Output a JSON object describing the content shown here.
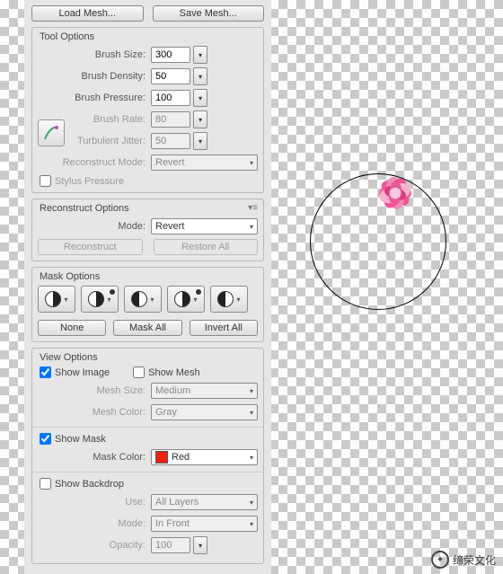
{
  "top_buttons": {
    "load_mesh": "Load Mesh...",
    "save_mesh": "Save Mesh..."
  },
  "tool_options": {
    "title": "Tool Options",
    "brush_size_label": "Brush Size:",
    "brush_size": "300",
    "brush_density_label": "Brush Density:",
    "brush_density": "50",
    "brush_pressure_label": "Brush Pressure:",
    "brush_pressure": "100",
    "brush_rate_label": "Brush Rate:",
    "brush_rate": "80",
    "turbulent_jitter_label": "Turbulent Jitter:",
    "turbulent_jitter": "50",
    "reconstruct_mode_label": "Reconstruct Mode:",
    "reconstruct_mode_value": "Revert",
    "stylus_pressure_label": "Stylus Pressure"
  },
  "reconstruct_options": {
    "title": "Reconstruct Options",
    "mode_label": "Mode:",
    "mode_value": "Revert",
    "reconstruct_btn": "Reconstruct",
    "restore_btn": "Restore All"
  },
  "mask_options": {
    "title": "Mask Options",
    "none": "None",
    "mask_all": "Mask All",
    "invert_all": "Invert All"
  },
  "view_options": {
    "title": "View Options",
    "show_image": "Show Image",
    "show_mesh": "Show Mesh",
    "mesh_size_label": "Mesh Size:",
    "mesh_size_value": "Medium",
    "mesh_color_label": "Mesh Color:",
    "mesh_color_value": "Gray",
    "show_mask": "Show Mask",
    "mask_color_label": "Mask Color:",
    "mask_color_value": "Red",
    "show_backdrop": "Show Backdrop",
    "use_label": "Use:",
    "use_value": "All Layers",
    "backdrop_mode_label": "Mode:",
    "backdrop_mode_value": "In Front",
    "opacity_label": "Opacity:",
    "opacity_value": "100"
  },
  "watermark": "缔荣文化"
}
